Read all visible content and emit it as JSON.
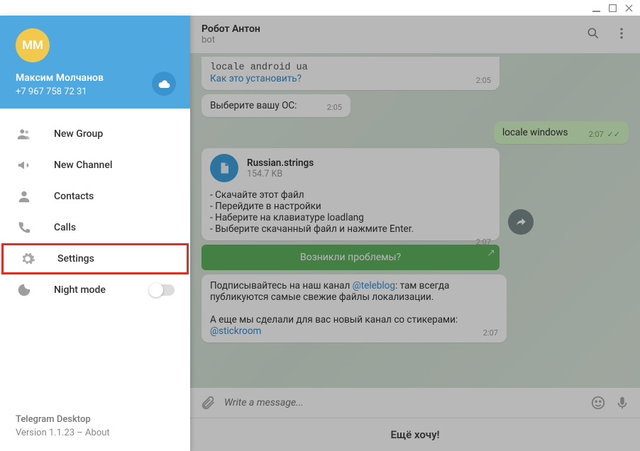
{
  "profile": {
    "initials": "MM",
    "name": "Максим Молчанов",
    "phone": "+7 967 758 72 31"
  },
  "menu": {
    "new_group": "New Group",
    "new_channel": "New Channel",
    "contacts": "Contacts",
    "calls": "Calls",
    "settings": "Settings",
    "night_mode": "Night mode"
  },
  "footer": {
    "app": "Telegram Desktop",
    "version": "Version 1.1.23 – About"
  },
  "chat": {
    "title": "Робот Антон",
    "subtitle": "bot"
  },
  "messages": {
    "m1_code": "locale android ua",
    "m1_link": "Как это установить?",
    "m1_time": "2:05",
    "m2_text": "Выберите вашу ОС:",
    "m2_time": "2:05",
    "m3_text": "locale windows",
    "m3_time": "2:07",
    "m4_file_name": "Russian.strings",
    "m4_file_size": "154.7 KB",
    "m4_line1": "- Скачайте этот файл",
    "m4_line2": "- Перейдите в настройки",
    "m4_line3": "- Наберите на клавиатуре loadlang",
    "m4_line4": "- Выберите скачанный файл и нажмите Enter.",
    "m4_time": "2:07",
    "btn1": "Возникли проблемы?",
    "m5_p1a": "Подписывайтесь на наш канал ",
    "m5_link1": "@teleblog",
    "m5_p1b": ": там всегда публикуются самые свежие файлы локализации.",
    "m5_p2": "А еще мы сделали для вас новый канал со стикерами: ",
    "m5_link2": "@stickroom",
    "m5_time": "2:07"
  },
  "composer": {
    "placeholder": "Write a message..."
  },
  "bottom_button": "Ещё хочу!"
}
